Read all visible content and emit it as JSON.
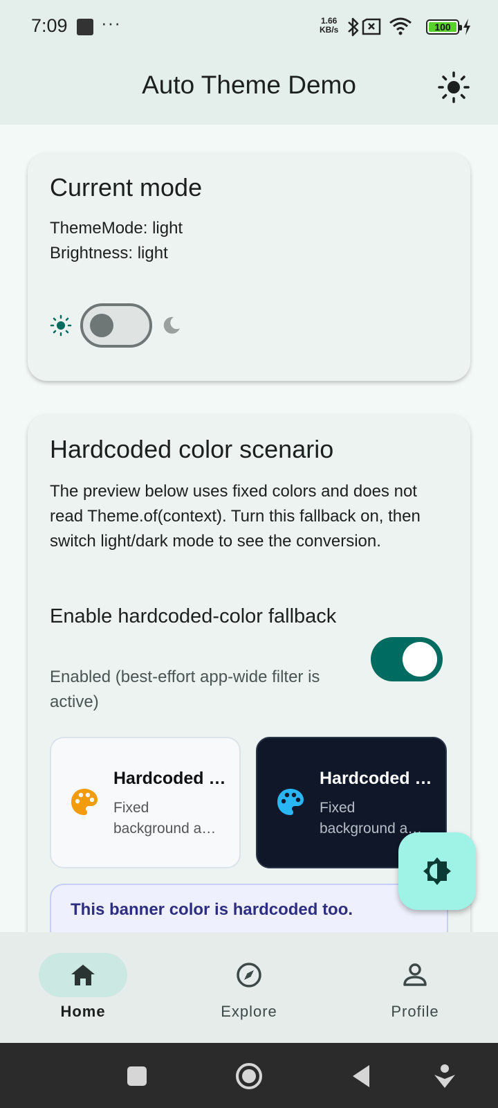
{
  "status_bar": {
    "time": "7:09",
    "more": "···",
    "speed_value": "1.66",
    "speed_unit": "KB/s",
    "battery": "100"
  },
  "app_bar": {
    "title": "Auto Theme Demo"
  },
  "current_mode": {
    "title": "Current mode",
    "theme_mode": "ThemeMode: light",
    "brightness": "Brightness: light",
    "toggle_on": false
  },
  "hardcoded": {
    "title": "Hardcoded color scenario",
    "description": "The preview below uses fixed colors and does not read Theme.of(context). Turn this fallback on, then switch light/dark mode to see the conversion.",
    "fallback_title": "Enable hardcoded-color fallback",
    "fallback_subtitle": "Enabled (best-effort app-wide filter is active)",
    "fallback_enabled": true,
    "tiles": [
      {
        "title": "Hardcoded …",
        "desc_line1": "Fixed",
        "desc_line2": "background a…",
        "icon": "palette-icon",
        "icon_color": "#f29b0c"
      },
      {
        "title": "Hardcoded …",
        "desc_line1": "Fixed",
        "desc_line2": "background a…",
        "icon": "palette-icon",
        "icon_color": "#2ab6f2"
      }
    ],
    "banner": "This banner color is hardcoded too."
  },
  "fab": {
    "icon": "brightness-icon"
  },
  "bottom_nav": [
    {
      "label": "Home",
      "icon": "home-icon",
      "active": true
    },
    {
      "label": "Explore",
      "icon": "compass-icon",
      "active": false
    },
    {
      "label": "Profile",
      "icon": "person-icon",
      "active": false
    }
  ],
  "colors": {
    "primary": "#006b60",
    "fab": "#9ef2e6",
    "nav_indicator": "#cce8e3",
    "banner_text": "#2d2e7f"
  }
}
